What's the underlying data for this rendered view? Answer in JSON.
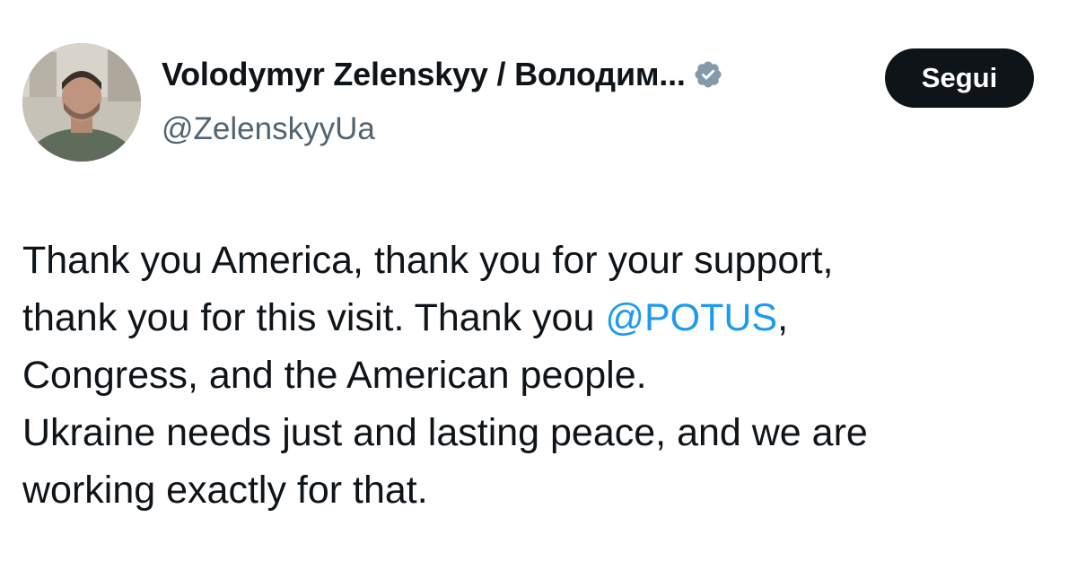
{
  "author": {
    "display_name": "Volodymyr Zelenskyy / Володим...",
    "handle": "@ZelenskyyUa",
    "verified_icon": "verified-badge-icon",
    "verified_color": "#829aab"
  },
  "follow_button": {
    "label": "Segui"
  },
  "tweet": {
    "line1": "Thank you America, thank you for your support,",
    "line2_before": "thank you for this visit. Thank you ",
    "line2_mention": "@POTUS",
    "line2_after": ",",
    "line3": "Congress, and the American people.",
    "line4": "Ukraine needs just and lasting peace, and we are",
    "line5": "working exactly for that."
  },
  "colors": {
    "mention": "#1d9bf0",
    "text": "#0f1419",
    "handle": "#536471",
    "button_bg": "#0f1419"
  }
}
